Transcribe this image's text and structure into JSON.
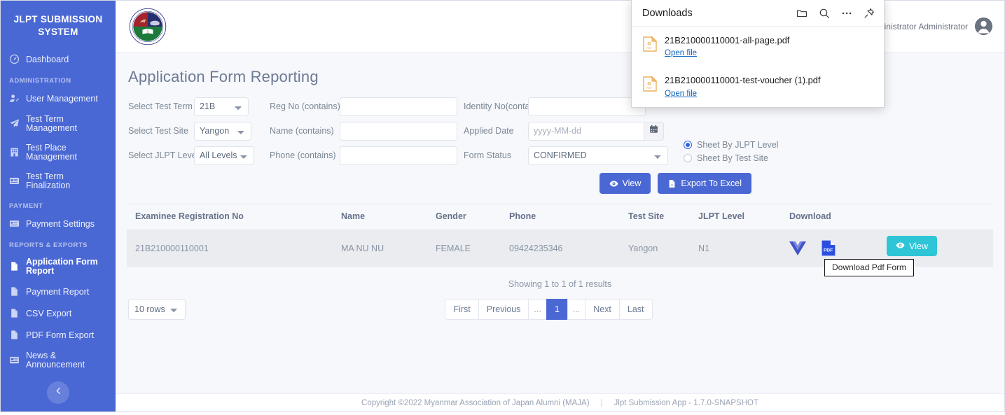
{
  "sidebar": {
    "brand": "JLPT SUBMISSION SYSTEM",
    "dashboard": {
      "label": "Dashboard",
      "icon": "dashboard-icon"
    },
    "sections": [
      {
        "title": "ADMINISTRATION",
        "items": [
          {
            "label": "User Management",
            "icon": "user-plus-icon",
            "active": false
          },
          {
            "label": "Test Term Management",
            "icon": "paper-plane-icon",
            "active": false
          },
          {
            "label": "Test Place Management",
            "icon": "building-icon",
            "active": false
          },
          {
            "label": "Test Term Finalization",
            "icon": "id-card-icon",
            "active": false
          }
        ]
      },
      {
        "title": "PAYMENT",
        "items": [
          {
            "label": "Payment Settings",
            "icon": "credit-card-icon",
            "active": false
          }
        ]
      },
      {
        "title": "REPORTS & EXPORTS",
        "items": [
          {
            "label": "Application Form Report",
            "icon": "file-icon",
            "active": true
          },
          {
            "label": "Payment Report",
            "icon": "file-icon",
            "active": false
          },
          {
            "label": "CSV Export",
            "icon": "file-icon",
            "active": false
          },
          {
            "label": "PDF Form Export",
            "icon": "file-icon",
            "active": false
          }
        ]
      },
      {
        "title": "",
        "items": [
          {
            "label": "News & Announcement",
            "icon": "newspaper-icon",
            "active": false
          }
        ]
      }
    ],
    "collapse_icon": "chevron-left-icon"
  },
  "topbar": {
    "logo": "maja-crest-logo",
    "user_name": "Administrator Administrator",
    "avatar_icon": "user-circle-icon"
  },
  "page": {
    "title": "Application Form Reporting"
  },
  "filters": {
    "test_term": {
      "label": "Select Test Term",
      "value": "21B",
      "options": [
        "21B"
      ]
    },
    "test_site": {
      "label": "Select Test Site",
      "value": "Yangon",
      "options": [
        "Yangon"
      ]
    },
    "jlpt_level": {
      "label": "Select JLPT Level",
      "value": "All Levels",
      "options": [
        "All Levels"
      ]
    },
    "reg_no": {
      "label": "Reg No (contains)",
      "value": "",
      "placeholder": ""
    },
    "name": {
      "label": "Name (contains)",
      "value": "",
      "placeholder": ""
    },
    "phone": {
      "label": "Phone (contains)",
      "value": "",
      "placeholder": ""
    },
    "identity_no": {
      "label": "Identity No(contains)",
      "value": "",
      "placeholder": ""
    },
    "applied_date": {
      "label": "Applied Date",
      "value": "",
      "placeholder": "yyyy-MM-dd",
      "calendar_icon": "calendar-icon"
    },
    "form_status": {
      "label": "Form Status",
      "value": "CONFIRMED",
      "options": [
        "CONFIRMED"
      ]
    },
    "sheet_mode": {
      "selected": "Sheet By JLPT Level",
      "options": [
        "Sheet By JLPT Level",
        "Sheet By Test Site"
      ]
    },
    "view_button": {
      "label": "View",
      "icon": "eye-icon"
    },
    "export_button": {
      "label": "Export To Excel",
      "icon": "excel-file-icon"
    }
  },
  "table": {
    "columns": [
      "Examinee Registration No",
      "Name",
      "Gender",
      "Phone",
      "Test Site",
      "JLPT Level",
      "Download"
    ],
    "rows": [
      {
        "reg_no": "21B210000110001",
        "name": "MA NU NU",
        "gender": "FEMALE",
        "phone": "09424235346",
        "test_site": "Yangon",
        "jlpt_level": "N1",
        "download_icons": [
          "voucher-v-icon",
          "pdf-file-icon"
        ],
        "view_label": "View",
        "view_icon": "eye-icon"
      }
    ],
    "tooltip": "Download Pdf Form"
  },
  "pagination": {
    "showing": "Showing 1 to 1 of 1 results",
    "rows_per_page": {
      "value": "10 rows",
      "options": [
        "10 rows"
      ]
    },
    "first": "First",
    "previous": "Previous",
    "dots_left": "...",
    "current_page": "1",
    "dots_right": "...",
    "next": "Next",
    "last": "Last"
  },
  "footer": {
    "copyright": "Copyright ©2022 Myanmar Association of Japan Alumni (MAJA)",
    "separator": "|",
    "app_version": "Jlpt Submission App - 1.7.0-SNAPSHOT"
  },
  "downloads_popup": {
    "title": "Downloads",
    "actions": [
      {
        "name": "open-folder-icon"
      },
      {
        "name": "search-icon"
      },
      {
        "name": "more-options-icon"
      },
      {
        "name": "pin-icon"
      }
    ],
    "items": [
      {
        "filename": "21B210000110001-all-page.pdf",
        "open_label": "Open file",
        "icon": "pdf-file-icon"
      },
      {
        "filename": "21B210000110001-test-voucher (1).pdf",
        "open_label": "Open file",
        "icon": "pdf-file-icon"
      }
    ]
  },
  "colors": {
    "sidebar": "#4a68d4",
    "primary": "#4a68d4",
    "accent_teal": "#2ec5d6",
    "link_blue": "#0a65c2",
    "page_bg": "#f7f8fc"
  }
}
